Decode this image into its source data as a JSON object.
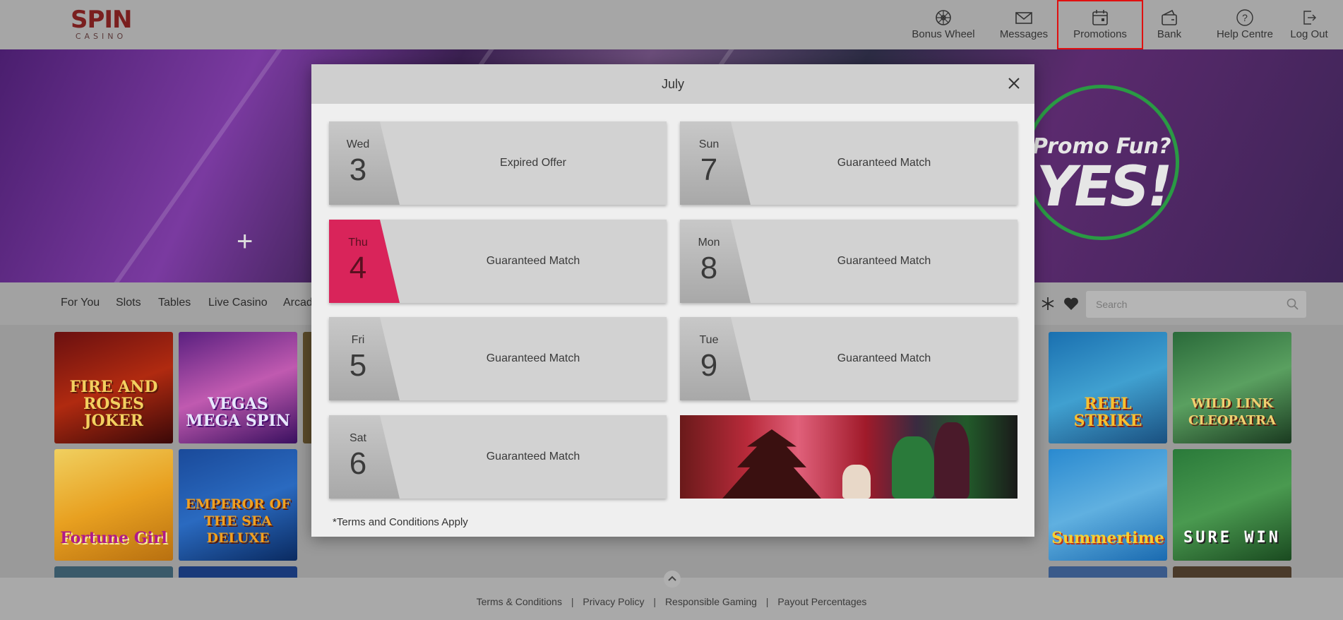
{
  "header": {
    "logo_top": "SPIN",
    "logo_bottom": "CASINO",
    "nav": [
      {
        "label": "Bonus Wheel",
        "icon": "wheel-icon"
      },
      {
        "label": "Messages",
        "icon": "envelope-icon"
      },
      {
        "label": "Promotions",
        "icon": "calendar-icon"
      },
      {
        "label": "Bank",
        "icon": "wallet-icon"
      },
      {
        "label": "Help Centre",
        "icon": "question-icon"
      },
      {
        "label": "Log Out",
        "icon": "logout-icon"
      }
    ]
  },
  "hero": {
    "promo_line1": "Promo Fun?",
    "promo_line2": "YES!"
  },
  "categories": [
    "For You",
    "Slots",
    "Tables",
    "Live Casino",
    "Arcad"
  ],
  "search": {
    "placeholder": "Search"
  },
  "games": [
    "FIRE AND ROSES JOKER",
    "VEGAS MEGA SPIN",
    "REEL STRIKE",
    "WILD LINK CLEOPATRA",
    "Fortune Girl",
    "EMPEROR OF THE SEA DELUXE",
    "Summertime",
    "SURE WIN"
  ],
  "modal": {
    "title": "July",
    "days": [
      {
        "dow": "Wed",
        "num": "3",
        "offer": "Expired Offer",
        "active": false
      },
      {
        "dow": "Sun",
        "num": "7",
        "offer": "Guaranteed Match",
        "active": false
      },
      {
        "dow": "Thu",
        "num": "4",
        "offer": "Guaranteed Match",
        "active": true
      },
      {
        "dow": "Mon",
        "num": "8",
        "offer": "Guaranteed Match",
        "active": false
      },
      {
        "dow": "Fri",
        "num": "5",
        "offer": "Guaranteed Match",
        "active": false
      },
      {
        "dow": "Tue",
        "num": "9",
        "offer": "Guaranteed Match",
        "active": false
      },
      {
        "dow": "Sat",
        "num": "6",
        "offer": "Guaranteed Match",
        "active": false
      }
    ],
    "terms": "*Terms and Conditions Apply"
  },
  "footer": {
    "links": [
      "Terms & Conditions",
      "Privacy Policy",
      "Responsible Gaming",
      "Payout Percentages"
    ],
    "separator": "|"
  },
  "colors": {
    "active_day": "#d9245a",
    "highlight_outline": "#e01010"
  }
}
